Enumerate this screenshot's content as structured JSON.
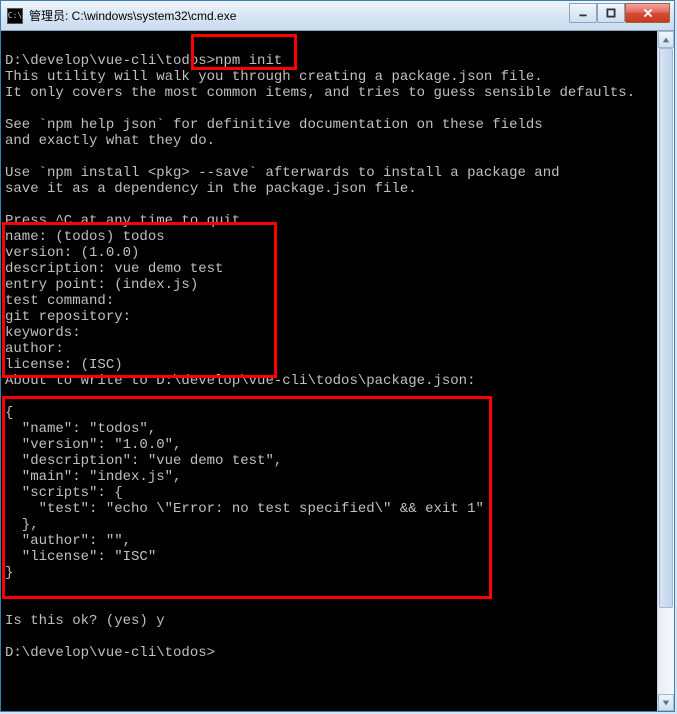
{
  "window": {
    "title": "管理员: C:\\windows\\system32\\cmd.exe"
  },
  "terminal": {
    "prompt1": "D:\\develop\\vue-cli\\todos>",
    "command1": "npm init",
    "intro1": "This utility will walk you through creating a package.json file.",
    "intro2": "It only covers the most common items, and tries to guess sensible defaults.",
    "intro3": "See `npm help json` for definitive documentation on these fields",
    "intro4": "and exactly what they do.",
    "intro5": "Use `npm install <pkg> --save` afterwards to install a package and",
    "intro6": "save it as a dependency in the package.json file.",
    "intro7": "Press ^C at any time to quit.",
    "q_name": "name: (todos) todos",
    "q_version": "version: (1.0.0)",
    "q_desc": "description: vue demo test",
    "q_entry": "entry point: (index.js)",
    "q_test": "test command:",
    "q_git": "git repository:",
    "q_keywords": "keywords:",
    "q_author": "author:",
    "q_license": "license: (ISC)",
    "about_write": "About to write to D:\\develop\\vue-cli\\todos\\package.json:",
    "json_open": "{",
    "json_name": "  \"name\": \"todos\",",
    "json_version": "  \"version\": \"1.0.0\",",
    "json_desc": "  \"description\": \"vue demo test\",",
    "json_main": "  \"main\": \"index.js\",",
    "json_scripts_open": "  \"scripts\": {",
    "json_test": "    \"test\": \"echo \\\"Error: no test specified\\\" && exit 1\"",
    "json_scripts_close": "  },",
    "json_author": "  \"author\": \"\",",
    "json_license": "  \"license\": \"ISC\"",
    "json_close": "}",
    "confirm": "Is this ok? (yes) y",
    "prompt2": "D:\\develop\\vue-cli\\todos>"
  }
}
